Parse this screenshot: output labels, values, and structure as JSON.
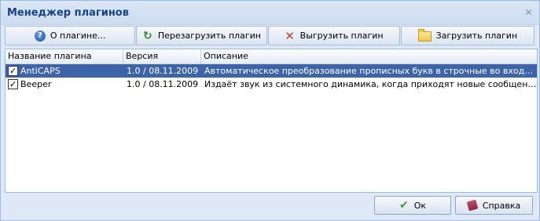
{
  "window": {
    "title": "Менеджер плагинов"
  },
  "toolbar": {
    "about": "О плагине...",
    "reload": "Перезагрузить плагин",
    "unload": "Выгрузить плагин",
    "load": "Загрузить плагин"
  },
  "grid": {
    "columns": [
      "Название плагина",
      "Версия",
      "Описание"
    ],
    "rows": [
      {
        "name": "AntiCAPS",
        "version": "1.0 / 08.11.2009",
        "description": "Автоматическое преобразование прописных букв в строчные во входящих со...",
        "checked": true,
        "selected": true
      },
      {
        "name": "Beeper",
        "version": "1.0 / 08.11.2009",
        "description": "Издаёт звук из системного динамика, когда приходят новые сообщения в кана...",
        "checked": true,
        "selected": false
      }
    ]
  },
  "footer": {
    "ok": "Ок",
    "help": "Справка"
  },
  "icons": {
    "about": "help-icon",
    "reload": "reload-icon",
    "unload": "unload-icon",
    "load": "folder-icon",
    "ok": "checkmark-icon",
    "help": "book-icon"
  },
  "colors": {
    "selection": "#3d63a8",
    "title_text": "#15428b",
    "window_bg": "#dfe8f6"
  }
}
